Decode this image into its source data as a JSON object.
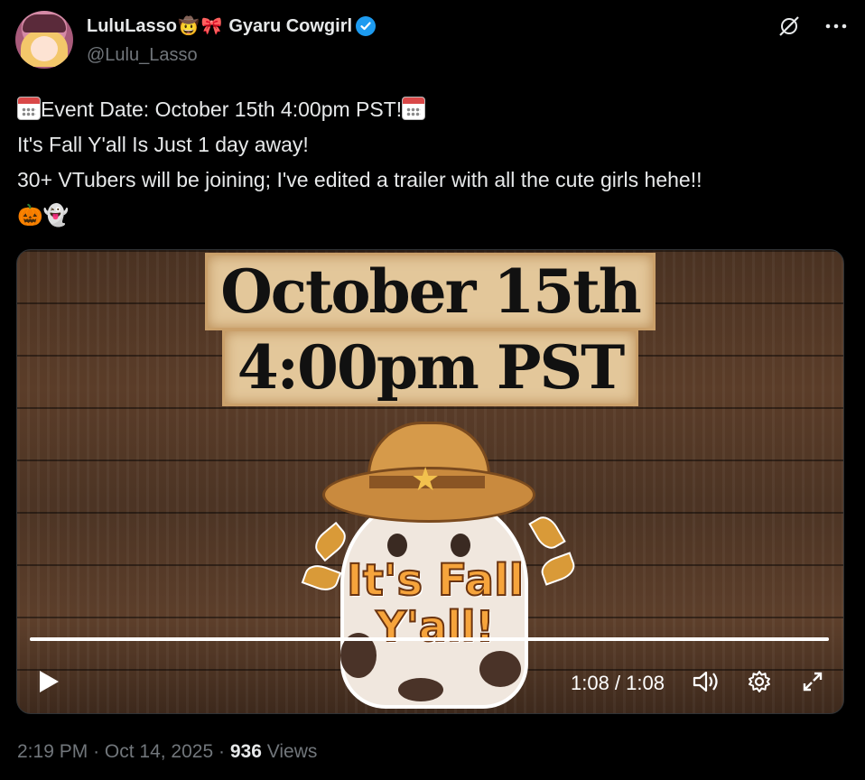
{
  "author": {
    "display_name": "LuluLasso",
    "name_emojis": [
      "🤠",
      "🎀"
    ],
    "name_suffix": "Gyaru Cowgirl",
    "handle": "@Lulu_Lasso",
    "verified": true
  },
  "header_icons": [
    "grok-icon",
    "more-icon"
  ],
  "tweet": {
    "line1": "Event Date: October 15th 4:00pm PST!",
    "line2": "It's Fall Y'all Is Just 1 day away!",
    "line3": "30+ VTubers will be joining; I've edited a trailer with all the cute girls hehe!!",
    "line4_emojis": "🎃👻"
  },
  "video": {
    "banner_line1": "October 15th",
    "banner_line2": "4:00pm PST",
    "logo_line1": "It's Fall",
    "logo_line2": "Y'all!",
    "time_display": "1:08 / 1:08",
    "progress": 1.0
  },
  "meta": {
    "time": "2:19 PM",
    "separator": "·",
    "date": "Oct 14, 2025",
    "views_count": "936",
    "views_label": "Views"
  },
  "colors": {
    "verified": "#1d9bf0",
    "muted": "#71767b",
    "text": "#e7e9ea"
  }
}
